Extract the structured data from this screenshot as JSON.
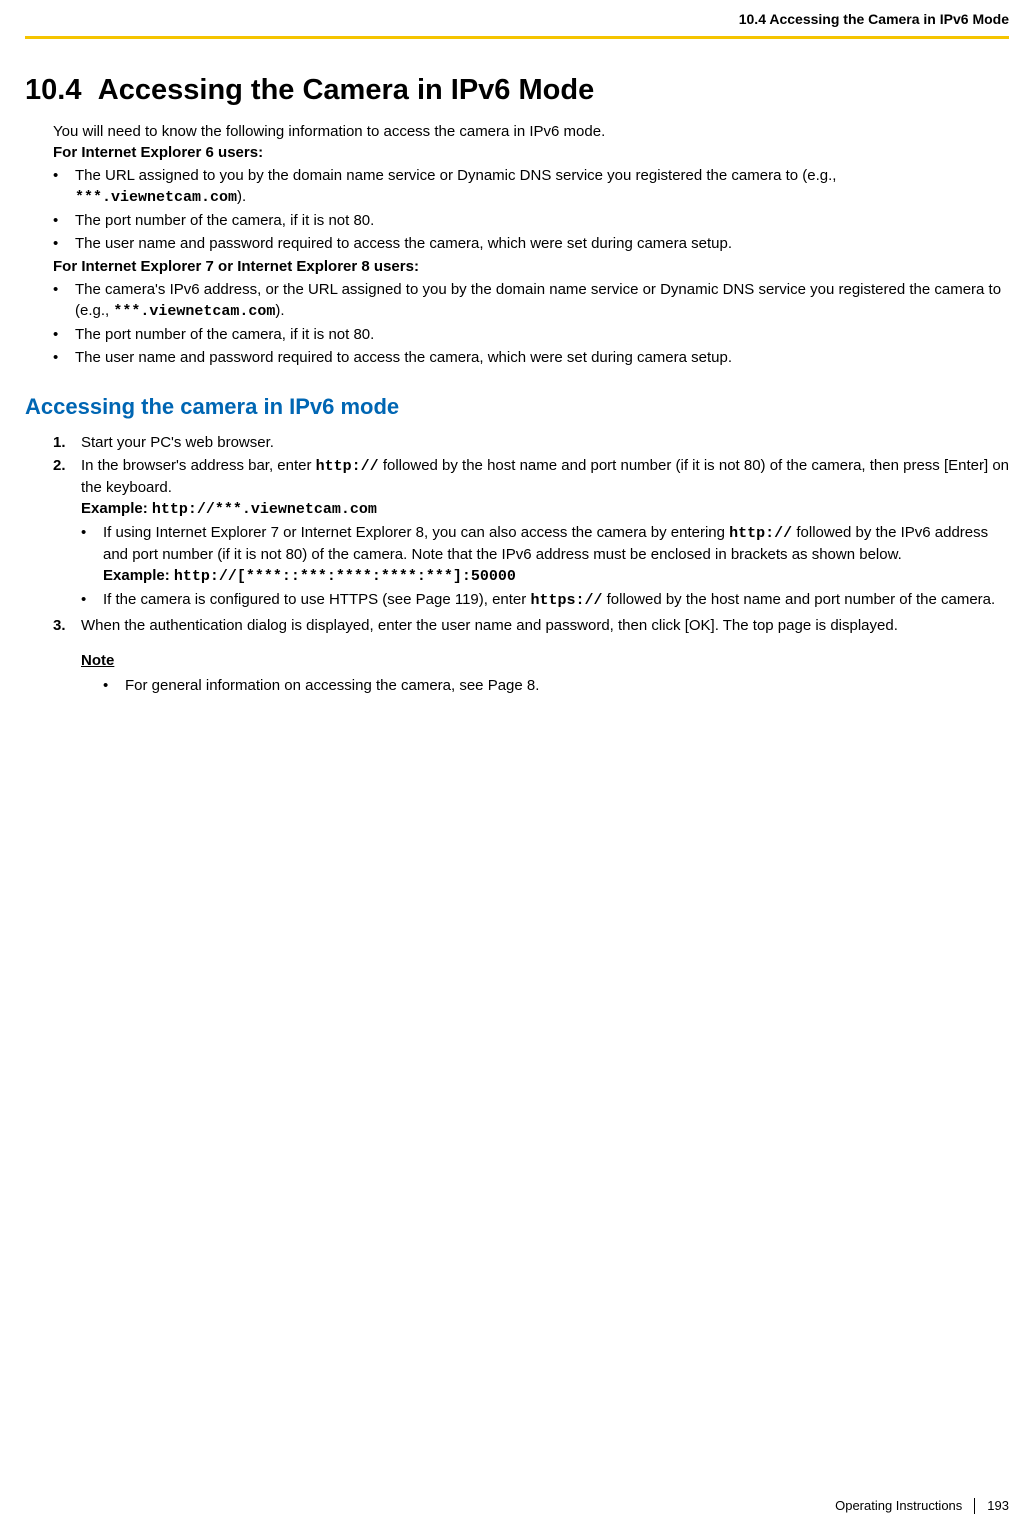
{
  "header": {
    "running_title": "10.4 Accessing the Camera in IPv6 Mode"
  },
  "title": {
    "number": "10.4",
    "text": "Accessing the Camera in IPv6 Mode"
  },
  "intro": "You will need to know the following information to access the camera in IPv6 mode.",
  "ie6": {
    "heading": "For Internet Explorer 6 users:",
    "b1a": "The URL assigned to you by the domain name service or Dynamic DNS service you registered the camera to (e.g., ",
    "b1code": "***.viewnetcam.com",
    "b1b": ").",
    "b2": "The port number of the camera, if it is not 80.",
    "b3": "The user name and password required to access the camera, which were set during camera setup."
  },
  "ie78": {
    "heading": "For Internet Explorer 7 or Internet Explorer 8 users:",
    "b1a": "The camera's IPv6 address, or the URL assigned to you by the domain name service or Dynamic DNS service you registered the camera to (e.g., ",
    "b1code": "***.viewnetcam.com",
    "b1b": ").",
    "b2": "The port number of the camera, if it is not 80.",
    "b3": "The user name and password required to access the camera, which were set during camera setup."
  },
  "subsection": "Accessing the camera in IPv6 mode",
  "steps": {
    "s1": "Start your PC's web browser.",
    "s2a": "In the browser's address bar, enter ",
    "s2code1": "http://",
    "s2b": " followed by the host name and port number (if it is not 80) of the camera, then press [Enter] on the keyboard.",
    "s2ex_label": "Example: ",
    "s2ex_code": "http://***.viewnetcam.com",
    "s2sub1a": "If using Internet Explorer 7 or Internet Explorer 8, you can also access the camera by entering ",
    "s2sub1code1": "http://",
    "s2sub1b": " followed by the IPv6 address and port number (if it is not 80) of the camera. Note that the IPv6 address must be enclosed in brackets as shown below.",
    "s2sub1ex_label": "Example: ",
    "s2sub1ex_code": "http://[****::***:****:****:***]:50000",
    "s2sub2a": "If the camera is configured to use HTTPS (see Page 119), enter ",
    "s2sub2code": "https://",
    "s2sub2b": " followed by the host name and port number of the camera.",
    "s3": "When the authentication dialog is displayed, enter the user name and password, then click [OK]. The top page is displayed."
  },
  "note": {
    "heading": "Note",
    "item": "For general information on accessing the camera, see Page 8."
  },
  "footer": {
    "doc_title": "Operating Instructions",
    "page": "193"
  }
}
